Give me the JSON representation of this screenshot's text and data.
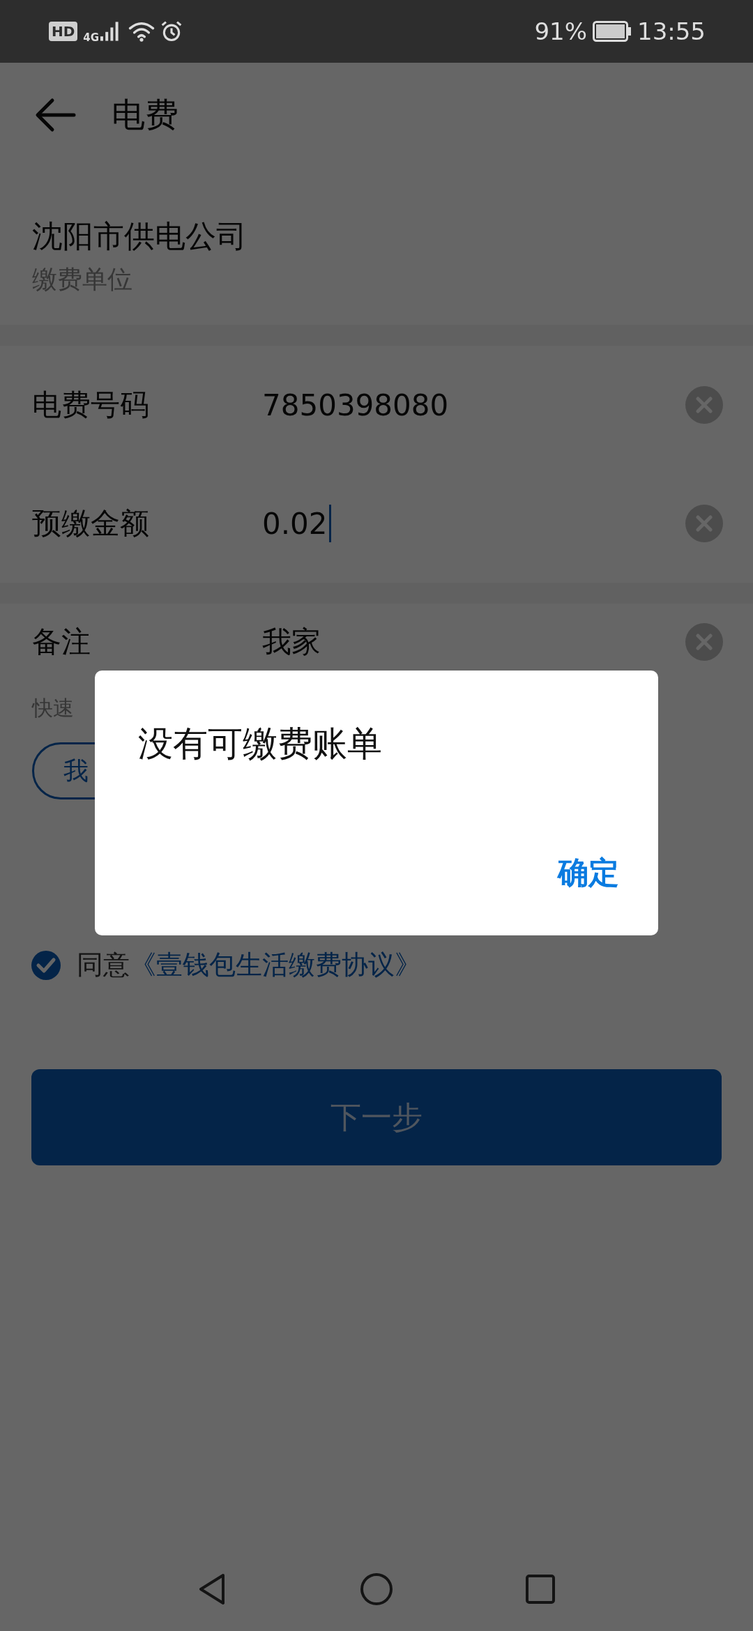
{
  "status_bar": {
    "time": "13:55",
    "battery": "91%",
    "hd": "HD",
    "network": "4G"
  },
  "header": {
    "title": "电费"
  },
  "payee": {
    "name": "沈阳市供电公司",
    "label": "缴费单位"
  },
  "fields": [
    {
      "label": "电费号码",
      "value": "7850398080",
      "focused": false
    },
    {
      "label": "预缴金额",
      "value": "0.02",
      "focused": true
    }
  ],
  "note": {
    "label": "备注",
    "value": "我家"
  },
  "quick_select": {
    "label": "快速",
    "chips": [
      "我"
    ]
  },
  "agreement": {
    "checked": true,
    "text": "同意",
    "link": "《壹钱包生活缴费协议》"
  },
  "next_button": {
    "label": "下一步"
  },
  "dialog": {
    "message": "没有可缴费账单",
    "confirm": "确定"
  }
}
